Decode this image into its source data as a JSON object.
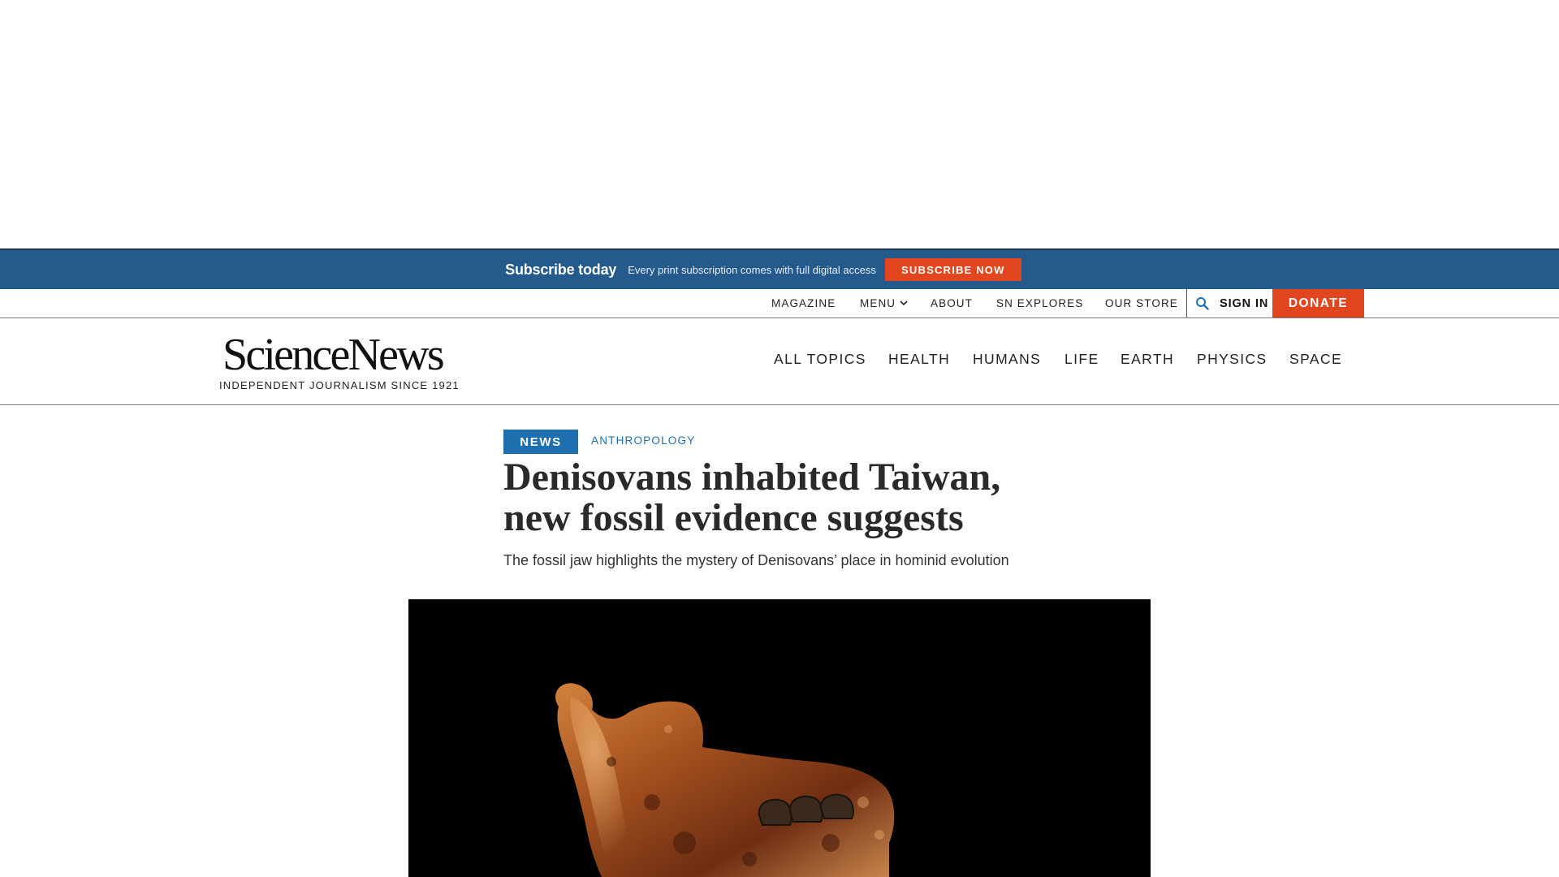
{
  "subscribe_bar": {
    "title": "Subscribe today",
    "description": "Every print subscription comes with full digital access",
    "button_label": "SUBSCRIBE NOW"
  },
  "utility_nav": {
    "items": [
      "MAGAZINE",
      "MENU",
      "ABOUT",
      "SN EXPLORES",
      "OUR STORE"
    ],
    "sign_in": "SIGN IN",
    "donate": "DONATE"
  },
  "masthead": {
    "logo_text": "ScienceNews",
    "tagline": "INDEPENDENT JOURNALISM SINCE 1921",
    "nav": [
      "ALL TOPICS",
      "HEALTH",
      "HUMANS",
      "LIFE",
      "EARTH",
      "PHYSICS",
      "SPACE"
    ]
  },
  "article": {
    "type_tag": "NEWS",
    "topic_tag": "ANTHROPOLOGY",
    "headline_line1": "Denisovans inhabited Taiwan,",
    "headline_line2": "new fossil evidence suggests",
    "dek": "The fossil jaw highlights the mystery of Denisovans’ place in hominid evolution"
  },
  "colors": {
    "subscribe_bar": "#245b8c",
    "accent_orange": "#e2461f",
    "tag_blue": "#1e6fb0"
  }
}
